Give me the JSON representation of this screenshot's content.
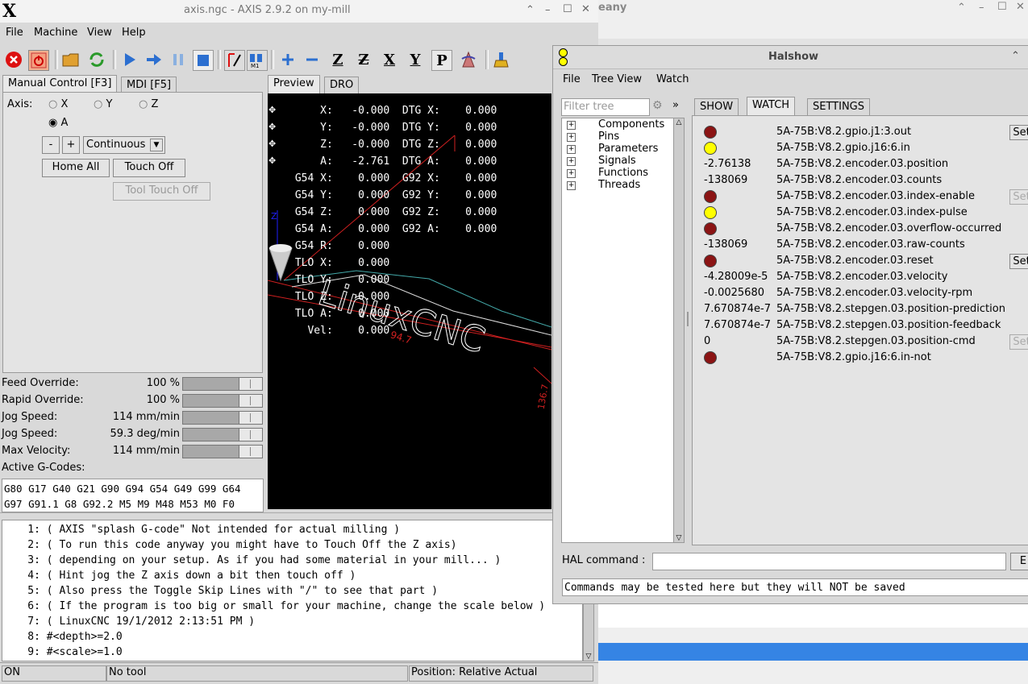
{
  "axis_window": {
    "logo": "X",
    "title": "axis.ngc - AXIS 2.9.2 on my-mill",
    "menu": [
      "File",
      "Machine",
      "View",
      "Help"
    ],
    "tabs": [
      "Manual Control [F3]",
      "MDI [F5]"
    ],
    "axis_label": "Axis:",
    "axes": [
      "X",
      "Y",
      "Z",
      "A"
    ],
    "selected_axis": "A",
    "jog_minus": "-",
    "jog_plus": "+",
    "jog_mode": "Continuous",
    "home_all": "Home All",
    "touch_off": "Touch Off",
    "tool_touch_off": "Tool Touch Off",
    "view_tabs": [
      "Preview",
      "DRO"
    ],
    "dro_lines": [
      "     X:   -0.000  DTG X:    0.000",
      "     Y:   -0.000  DTG Y:    0.000",
      "     Z:   -0.000  DTG Z:    0.000",
      "     A:   -2.761  DTG A:    0.000",
      " G54 X:    0.000  G92 X:    0.000",
      " G54 Y:    0.000  G92 Y:    0.000",
      " G54 Z:    0.000  G92 Z:    0.000",
      " G54 A:    0.000  G92 A:    0.000",
      " G54 R:    0.000",
      " TLO X:    0.000",
      " TLO Y:    0.000",
      " TLO Z:    0.000",
      " TLO A:    0.000",
      "   Vel:    0.000"
    ],
    "preview_dims": [
      "94.7",
      "136.7"
    ],
    "overrides": [
      {
        "label": "Feed Override:",
        "value": "100 %"
      },
      {
        "label": "Rapid Override:",
        "value": "100 %"
      },
      {
        "label": "Jog Speed:",
        "value": "114 mm/min"
      },
      {
        "label": "Jog Speed:",
        "value": "59.3 deg/min"
      },
      {
        "label": "Max Velocity:",
        "value": "114 mm/min"
      }
    ],
    "active_gcodes_label": "Active G-Codes:",
    "active_gcodes": [
      "G80 G17 G40 G21 G90 G94 G54 G49 G99 G64",
      "G97 G91.1 G8 G92.2 M5 M9 M48 M53 M0 F0"
    ],
    "code_lines": [
      "    1: ( AXIS \"splash G-code\" Not intended for actual milling )",
      "    2: ( To run this code anyway you might have to Touch Off the Z axis)",
      "    3: ( depending on your setup. As if you had some material in your mill... )",
      "    4: ( Hint jog the Z axis down a bit then touch off )",
      "    5: ( Also press the Toggle Skip Lines with \"/\" to see that part )",
      "    6: ( If the program is too big or small for your machine, change the scale below )",
      "    7: ( LinuxCNC 19/1/2012 2:13:51 PM )",
      "    8: #<depth>=2.0",
      "    9: #<scale>=1.0"
    ],
    "status": [
      "ON",
      "No tool",
      "Position: Relative Actual"
    ]
  },
  "background_window": {
    "title_fragment": "eany"
  },
  "halshow": {
    "title": "Halshow",
    "menu": [
      "File",
      "Tree View",
      "Watch"
    ],
    "filter_placeholder": "Filter tree",
    "more": "»",
    "tabs": [
      "SHOW",
      "WATCH",
      "SETTINGS"
    ],
    "tree": [
      "Components",
      "Pins",
      "Parameters",
      "Signals",
      "Functions",
      "Threads"
    ],
    "watch": [
      {
        "type": "led",
        "color": "#8b1414",
        "name": "5A-75B:V8.2.gpio.j1:3.out",
        "action": "Set"
      },
      {
        "type": "led",
        "color": "#ffff00",
        "name": "5A-75B:V8.2.gpio.j16:6.in"
      },
      {
        "type": "value",
        "value": "-2.76138",
        "name": "5A-75B:V8.2.encoder.03.position"
      },
      {
        "type": "value",
        "value": "-138069",
        "name": "5A-75B:V8.2.encoder.03.counts"
      },
      {
        "type": "led",
        "color": "#8b1414",
        "name": "5A-75B:V8.2.encoder.03.index-enable",
        "action": "Set",
        "disabled": true
      },
      {
        "type": "led",
        "color": "#ffff00",
        "name": "5A-75B:V8.2.encoder.03.index-pulse"
      },
      {
        "type": "led",
        "color": "#8b1414",
        "name": "5A-75B:V8.2.encoder.03.overflow-occurred"
      },
      {
        "type": "value",
        "value": "-138069",
        "name": "5A-75B:V8.2.encoder.03.raw-counts"
      },
      {
        "type": "led",
        "color": "#8b1414",
        "name": "5A-75B:V8.2.encoder.03.reset",
        "action": "Set"
      },
      {
        "type": "value",
        "value": "-4.28009e-5",
        "name": "5A-75B:V8.2.encoder.03.velocity"
      },
      {
        "type": "value",
        "value": "-0.0025680",
        "name": "5A-75B:V8.2.encoder.03.velocity-rpm"
      },
      {
        "type": "value",
        "value": "7.670874e-7",
        "name": "5A-75B:V8.2.stepgen.03.position-prediction"
      },
      {
        "type": "value",
        "value": "7.670874e-7",
        "name": "5A-75B:V8.2.stepgen.03.position-feedback"
      },
      {
        "type": "value",
        "value": "0",
        "name": "5A-75B:V8.2.stepgen.03.position-cmd",
        "action": "Set",
        "disabled": true
      },
      {
        "type": "led",
        "color": "#8b1414",
        "name": "5A-75B:V8.2.gpio.j16:6.in-not"
      }
    ],
    "hal_command_label": "HAL command :",
    "execute_fragment": "E",
    "hint": "Commands may be tested here but they will NOT be saved"
  }
}
